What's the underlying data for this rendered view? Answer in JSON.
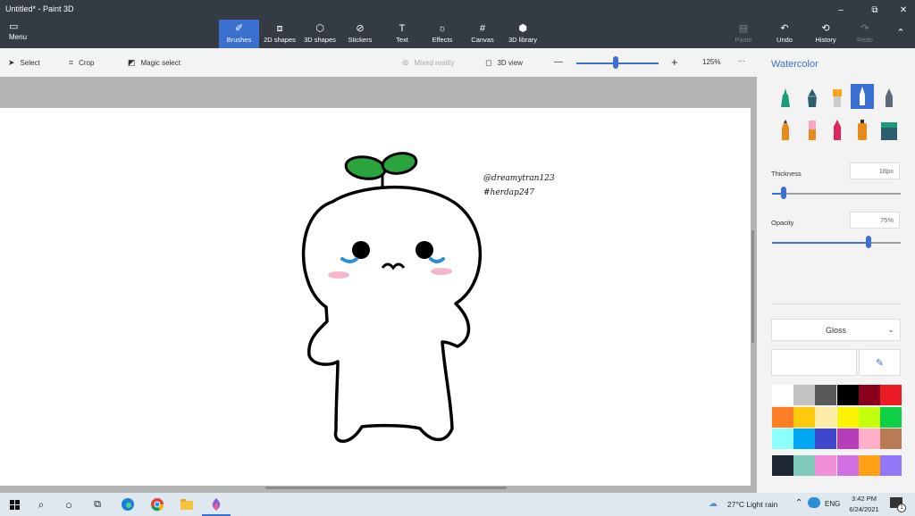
{
  "window": {
    "title": "Untitled* - Paint 3D",
    "controls": {
      "minimize": "–",
      "restore": "⧉",
      "close": "✕"
    }
  },
  "ribbon": {
    "menu": {
      "label": "Menu",
      "icon": "folder-icon"
    },
    "tools": [
      {
        "label": "Brushes",
        "icon": "brush-icon",
        "active": true
      },
      {
        "label": "2D shapes",
        "icon": "2d-shapes-icon"
      },
      {
        "label": "3D shapes",
        "icon": "3d-shapes-icon"
      },
      {
        "label": "Stickers",
        "icon": "sticker-icon"
      },
      {
        "label": "Text",
        "icon": "text-icon"
      },
      {
        "label": "Effects",
        "icon": "effects-icon"
      },
      {
        "label": "Canvas",
        "icon": "canvas-icon"
      },
      {
        "label": "3D library",
        "icon": "3d-library-icon"
      }
    ],
    "right_actions": [
      {
        "label": "Paste",
        "icon": "paste-icon",
        "enabled": false
      },
      {
        "label": "Undo",
        "icon": "undo-icon",
        "enabled": true
      },
      {
        "label": "History",
        "icon": "history-icon",
        "enabled": true
      },
      {
        "label": "Redo",
        "icon": "redo-icon",
        "enabled": false
      }
    ]
  },
  "toolbar": {
    "select": "Select",
    "crop": "Crop",
    "magic_select": "Magic select",
    "mixed_reality": "Mixed reality",
    "view_3d": "3D view",
    "zoom_minus": "—",
    "zoom_plus": "+",
    "zoom_value": "125%",
    "zoom_fraction": 0.48,
    "more": "···"
  },
  "canvas_drawing": {
    "signature_line1": "@dreamytran123",
    "signature_line2": "#herdap247"
  },
  "panel": {
    "title": "Watercolor",
    "brushes": [
      {
        "name": "marker",
        "color": "#1a9b7a"
      },
      {
        "name": "calligraphy-pen",
        "color": "#1a9b7a"
      },
      {
        "name": "oil-brush",
        "color": "#f5a623"
      },
      {
        "name": "watercolor",
        "color": "#ffffff",
        "active": true
      },
      {
        "name": "pixel-pen",
        "color": "#1a9b7a"
      },
      {
        "name": "pencil",
        "color": "#e78a1c"
      },
      {
        "name": "eraser",
        "color": "#f7a9c4"
      },
      {
        "name": "crayon",
        "color": "#e0245e"
      },
      {
        "name": "spray-can",
        "color": "#e78a1c"
      },
      {
        "name": "fill",
        "color": "#1a9b7a"
      }
    ],
    "thickness_label": "Thickness",
    "thickness_value": "18px",
    "thickness_fraction": 0.09,
    "opacity_label": "Opacity",
    "opacity_value": "75%",
    "opacity_fraction": 0.75,
    "finish": "Gloss",
    "palette": [
      "#ffffff",
      "#c3c3c3",
      "#585858",
      "#000000",
      "#88001b",
      "#ec1c24",
      "#ff7f27",
      "#ffc90e",
      "#fdeca6",
      "#fff200",
      "#c4ff0e",
      "#0ed145",
      "#8cfffb",
      "#00a8f3",
      "#3f48cc",
      "#b83dba",
      "#ffaec8",
      "#b97a56",
      "#1e2632",
      "#7fcab8",
      "#f18ed8",
      "#d16fe3",
      "#ffa015",
      "#9178f7"
    ]
  },
  "taskbar": {
    "weather": "27°C  Light rain",
    "language": "ENG",
    "time": "3:42 PM",
    "date": "6/24/2021",
    "notification_count": "1"
  }
}
